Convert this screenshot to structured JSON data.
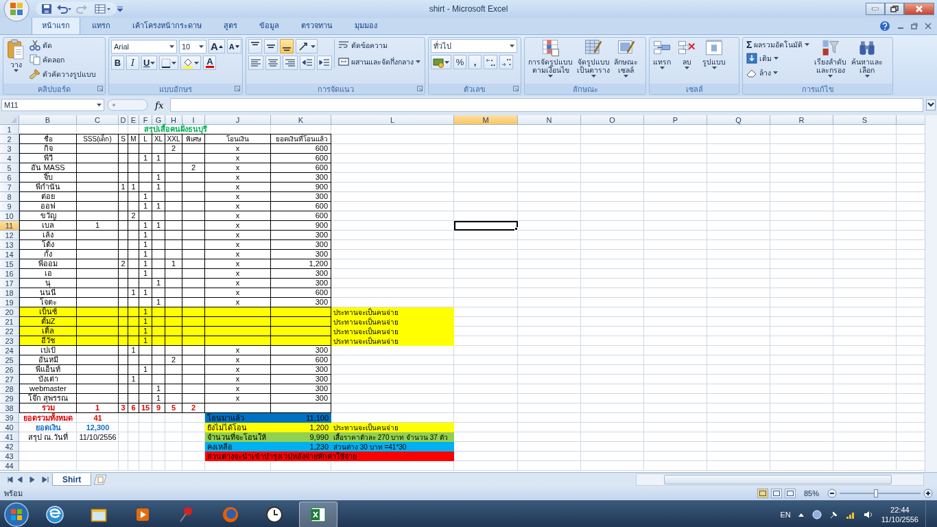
{
  "window": {
    "title": "shirt - Microsoft Excel"
  },
  "ribbon": {
    "tabs": [
      {
        "label": "หน้าแรก",
        "selected": true
      },
      {
        "label": "แทรก",
        "selected": false
      },
      {
        "label": "เค้าโครงหน้ากระดาษ",
        "selected": false
      },
      {
        "label": "สูตร",
        "selected": false
      },
      {
        "label": "ข้อมูล",
        "selected": false
      },
      {
        "label": "ตรวจทาน",
        "selected": false
      },
      {
        "label": "มุมมอง",
        "selected": false
      }
    ],
    "clipboard": {
      "label": "คลิปบอร์ด",
      "paste": "วาง",
      "cut": "ตัด",
      "copy": "คัดลอก",
      "format_painter": "ตัวคัดวางรูปแบบ"
    },
    "font": {
      "label": "แบบอักษร",
      "font_name": "Arial",
      "font_size": "10",
      "grow": "A",
      "shrink": "A",
      "bold": "B",
      "italic": "I",
      "underline": "U",
      "font_color": "A"
    },
    "alignment": {
      "label": "การจัดแนว",
      "vertical": [
        {
          "selected": false
        },
        {
          "selected": false
        },
        {
          "selected": true
        }
      ],
      "wrap_text": "ตัดข้อความ",
      "merge_center": "ผสานและจัดกึ่งกลาง"
    },
    "number": {
      "label": "ตัวเลข",
      "format": "ทั่วไป",
      "percent": "%",
      "comma": ","
    },
    "styles": {
      "label": "ลักษณะ",
      "buttons": [
        {
          "lines": [
            "การจัดรูปแบบ",
            "ตามเงื่อนไข"
          ]
        },
        {
          "lines": [
            "จัดรูปแบบ",
            "เป็นตาราง"
          ]
        },
        {
          "lines": [
            "ลักษณะ",
            "เซลล์"
          ]
        }
      ]
    },
    "cells": {
      "label": "เซลล์",
      "buttons": [
        "แทรก",
        "ลบ",
        "รูปแบบ"
      ]
    },
    "editing": {
      "label": "การแก้ไข",
      "sigma": "Σ",
      "autosum": "ผลรวมอัตโนมัติ",
      "fill": "เติม",
      "clear": "ล้าง",
      "sort": [
        "เรียงลำดับ",
        "และกรอง"
      ],
      "find": [
        "ค้นหาและ",
        "เลือก"
      ]
    }
  },
  "formula_bar": {
    "name_box": "M11",
    "function_label": "fx"
  },
  "sheet": {
    "columns": [
      {
        "label": "B",
        "selected": false
      },
      {
        "label": "C",
        "selected": false
      },
      {
        "label": "D",
        "selected": false
      },
      {
        "label": "E",
        "selected": false
      },
      {
        "label": "F",
        "selected": false
      },
      {
        "label": "G",
        "selected": false
      },
      {
        "label": "H",
        "selected": false
      },
      {
        "label": "I",
        "selected": false
      },
      {
        "label": "J",
        "selected": false
      },
      {
        "label": "K",
        "selected": false
      },
      {
        "label": "L",
        "selected": false
      },
      {
        "label": "M",
        "selected": true
      },
      {
        "label": "N",
        "selected": false
      },
      {
        "label": "O",
        "selected": false
      },
      {
        "label": "P",
        "selected": false
      },
      {
        "label": "Q",
        "selected": false
      },
      {
        "label": "R",
        "selected": false
      },
      {
        "label": "S",
        "selected": false
      }
    ],
    "rows": [
      {
        "number": "1",
        "selected": false,
        "kind": "title",
        "cells": [
          "สรุปเสื้อคนฝั่งธนบุรี"
        ]
      },
      {
        "number": "2",
        "selected": false,
        "kind": "header",
        "cells": [
          "ชื่อ",
          "SSS(เด็ก)",
          "S",
          "M",
          "L",
          "XL",
          "XXL",
          "พิเศษ",
          "โอนเงิน",
          "ยอดเงินที่โอนแล้ว"
        ]
      },
      {
        "number": "3",
        "selected": false,
        "kind": "entry",
        "cells": [
          "กิจ",
          "",
          "",
          "",
          "",
          "",
          "2",
          "",
          "x",
          "600"
        ]
      },
      {
        "number": "4",
        "selected": false,
        "kind": "entry",
        "cells": [
          "พีวี",
          "",
          "",
          "",
          "1",
          "1",
          "",
          "",
          "x",
          "600"
        ]
      },
      {
        "number": "5",
        "selected": false,
        "kind": "entry",
        "cells": [
          "อัน MASS",
          "",
          "",
          "",
          "",
          "",
          "",
          "2",
          "x",
          "600"
        ]
      },
      {
        "number": "6",
        "selected": false,
        "kind": "entry",
        "cells": [
          "จิ๊บ",
          "",
          "",
          "",
          "",
          "1",
          "",
          "",
          "x",
          "300"
        ]
      },
      {
        "number": "7",
        "selected": false,
        "kind": "entry",
        "cells": [
          "พี่กำนัน",
          "",
          "1",
          "1",
          "",
          "1",
          "",
          "",
          "x",
          "900"
        ]
      },
      {
        "number": "8",
        "selected": false,
        "kind": "entry",
        "cells": [
          "ต่อย",
          "",
          "",
          "",
          "1",
          "",
          "",
          "",
          "x",
          "300"
        ]
      },
      {
        "number": "9",
        "selected": false,
        "kind": "entry",
        "cells": [
          "ออฟ",
          "",
          "",
          "",
          "1",
          "1",
          "",
          "",
          "x",
          "600"
        ]
      },
      {
        "number": "10",
        "selected": false,
        "kind": "entry",
        "cells": [
          "ขวัญ",
          "",
          "",
          "2",
          "",
          "",
          "",
          "",
          "x",
          "600"
        ]
      },
      {
        "number": "11",
        "selected": true,
        "kind": "entry",
        "cells": [
          "เบล",
          "1",
          "",
          "",
          "1",
          "1",
          "",
          "",
          "x",
          "900"
        ]
      },
      {
        "number": "12",
        "selected": false,
        "kind": "entry",
        "cells": [
          "เล้ง",
          "",
          "",
          "",
          "1",
          "",
          "",
          "",
          "x",
          "300"
        ]
      },
      {
        "number": "13",
        "selected": false,
        "kind": "entry",
        "cells": [
          "โต้ง",
          "",
          "",
          "",
          "1",
          "",
          "",
          "",
          "x",
          "300"
        ]
      },
      {
        "number": "14",
        "selected": false,
        "kind": "entry",
        "cells": [
          "กั้ง",
          "",
          "",
          "",
          "1",
          "",
          "",
          "",
          "x",
          "300"
        ]
      },
      {
        "number": "15",
        "selected": false,
        "kind": "entry",
        "cells": [
          "พี่ออม",
          "",
          "2",
          "",
          "1",
          "",
          "1",
          "",
          "x",
          "1,200"
        ]
      },
      {
        "number": "16",
        "selected": false,
        "kind": "entry",
        "cells": [
          "เอ",
          "",
          "",
          "",
          "1",
          "",
          "",
          "",
          "x",
          "300"
        ]
      },
      {
        "number": "17",
        "selected": false,
        "kind": "entry",
        "cells": [
          "นุ",
          "",
          "",
          "",
          "",
          "1",
          "",
          "",
          "x",
          "300"
        ]
      },
      {
        "number": "18",
        "selected": false,
        "kind": "entry",
        "cells": [
          "นนนี่",
          "",
          "",
          "1",
          "1",
          "",
          "",
          "",
          "x",
          "600"
        ]
      },
      {
        "number": "19",
        "selected": false,
        "kind": "entry",
        "cells": [
          "โจตะ",
          "",
          "",
          "",
          "",
          "1",
          "",
          "",
          "x",
          "300"
        ]
      },
      {
        "number": "20",
        "selected": false,
        "kind": "pending",
        "cells": [
          "เบ็นซ์",
          "",
          "",
          "",
          "1",
          "",
          "",
          "",
          "",
          "",
          "ประทานจะเป็นคนจ่าย"
        ]
      },
      {
        "number": "21",
        "selected": false,
        "kind": "pending",
        "cells": [
          "ตั้มZ",
          "",
          "",
          "",
          "1",
          "",
          "",
          "",
          "",
          "",
          "ประทานจะเป็นคนจ่าย"
        ]
      },
      {
        "number": "22",
        "selected": false,
        "kind": "pending",
        "cells": [
          "เติ้ล",
          "",
          "",
          "",
          "1",
          "",
          "",
          "",
          "",
          "",
          "ประทานจะเป็นคนจ่าย"
        ]
      },
      {
        "number": "23",
        "selected": false,
        "kind": "pending",
        "cells": [
          "อีวัช",
          "",
          "",
          "",
          "1",
          "",
          "",
          "",
          "",
          "",
          "ประทานจะเป็นคนจ่าย"
        ]
      },
      {
        "number": "24",
        "selected": false,
        "kind": "entry",
        "cells": [
          "เปเป้",
          "",
          "",
          "1",
          "",
          "",
          "",
          "",
          "x",
          "300"
        ]
      },
      {
        "number": "25",
        "selected": false,
        "kind": "entry",
        "cells": [
          "อันหมี",
          "",
          "",
          "",
          "",
          "",
          "2",
          "",
          "x",
          "600"
        ]
      },
      {
        "number": "26",
        "selected": false,
        "kind": "entry",
        "cells": [
          "พี่แอ็นท์",
          "",
          "",
          "",
          "1",
          "",
          "",
          "",
          "x",
          "300"
        ]
      },
      {
        "number": "27",
        "selected": false,
        "kind": "entry",
        "cells": [
          "บังเต่า",
          "",
          "",
          "1",
          "",
          "",
          "",
          "",
          "x",
          "300"
        ]
      },
      {
        "number": "28",
        "selected": false,
        "kind": "entry",
        "cells": [
          "webmaster",
          "",
          "",
          "",
          "",
          "1",
          "",
          "",
          "x",
          "300"
        ]
      },
      {
        "number": "29",
        "selected": false,
        "kind": "entry",
        "cells": [
          "โจ๊ก สุพรรณ",
          "",
          "",
          "",
          "",
          "1",
          "",
          "",
          "x",
          "300"
        ]
      },
      {
        "number": "38",
        "selected": false,
        "kind": "total",
        "cells": [
          "รวม",
          "1",
          "3",
          "6",
          "15",
          "9",
          "5",
          "2",
          "",
          ""
        ]
      },
      {
        "number": "39",
        "selected": false,
        "kind": "summary",
        "color": "#e00000",
        "label": "ยอดรวมทั้งหมด",
        "value": "41",
        "band": {
          "color": "#0070c0",
          "label": "โอนมาแล้ว",
          "amount": "11,100"
        }
      },
      {
        "number": "40",
        "selected": false,
        "kind": "summary",
        "color": "#0f6fc6",
        "label": "ยอดเงิน",
        "value": "12,300",
        "band": {
          "color": "#ffff00",
          "label": "ยังไม่ได้โอน",
          "amount": "1,200",
          "note": "ประทานจะเป็นคนจ่าย"
        }
      },
      {
        "number": "41",
        "selected": false,
        "kind": "summary",
        "label": "สรุป ณ.วันที่",
        "value": "11/10/2556",
        "band": {
          "color": "#92d050",
          "label": "จำนวนที่จะโอนให้",
          "amount": "9,990",
          "note": "เสื้อราคาตัวละ 270 บาท จำนวน 37 ตัว"
        }
      },
      {
        "number": "42",
        "selected": false,
        "kind": "summary",
        "band": {
          "color": "#00b0f0",
          "label": "คงเหลือ",
          "amount": "1,230",
          "note": "ส่วนต่าง 30 บาท =41*30"
        }
      },
      {
        "number": "43",
        "selected": false,
        "kind": "summary",
        "band": {
          "color": "#ff0000",
          "label": "ส่วนต่างจะนำเข้าบำรุงเวปหลังจ่ายหักค่าใช้จ่าย"
        }
      },
      {
        "number": "44",
        "selected": false,
        "kind": "blank"
      }
    ]
  },
  "sheet_tabs": [
    {
      "label": "Shirt",
      "selected": true
    }
  ],
  "status_bar": {
    "text": "พร้อม",
    "views": [
      {
        "selected": true
      },
      {
        "selected": false
      },
      {
        "selected": false
      }
    ],
    "zoom": "85%",
    "level": 0.45
  },
  "taskbar": {
    "apps": [
      {
        "selected": false
      },
      {
        "selected": false
      },
      {
        "selected": false
      },
      {
        "selected": false
      },
      {
        "selected": false
      },
      {
        "selected": false
      },
      {
        "selected": true
      }
    ],
    "language": "EN",
    "time": "22:44",
    "date": "11/10/2556"
  }
}
